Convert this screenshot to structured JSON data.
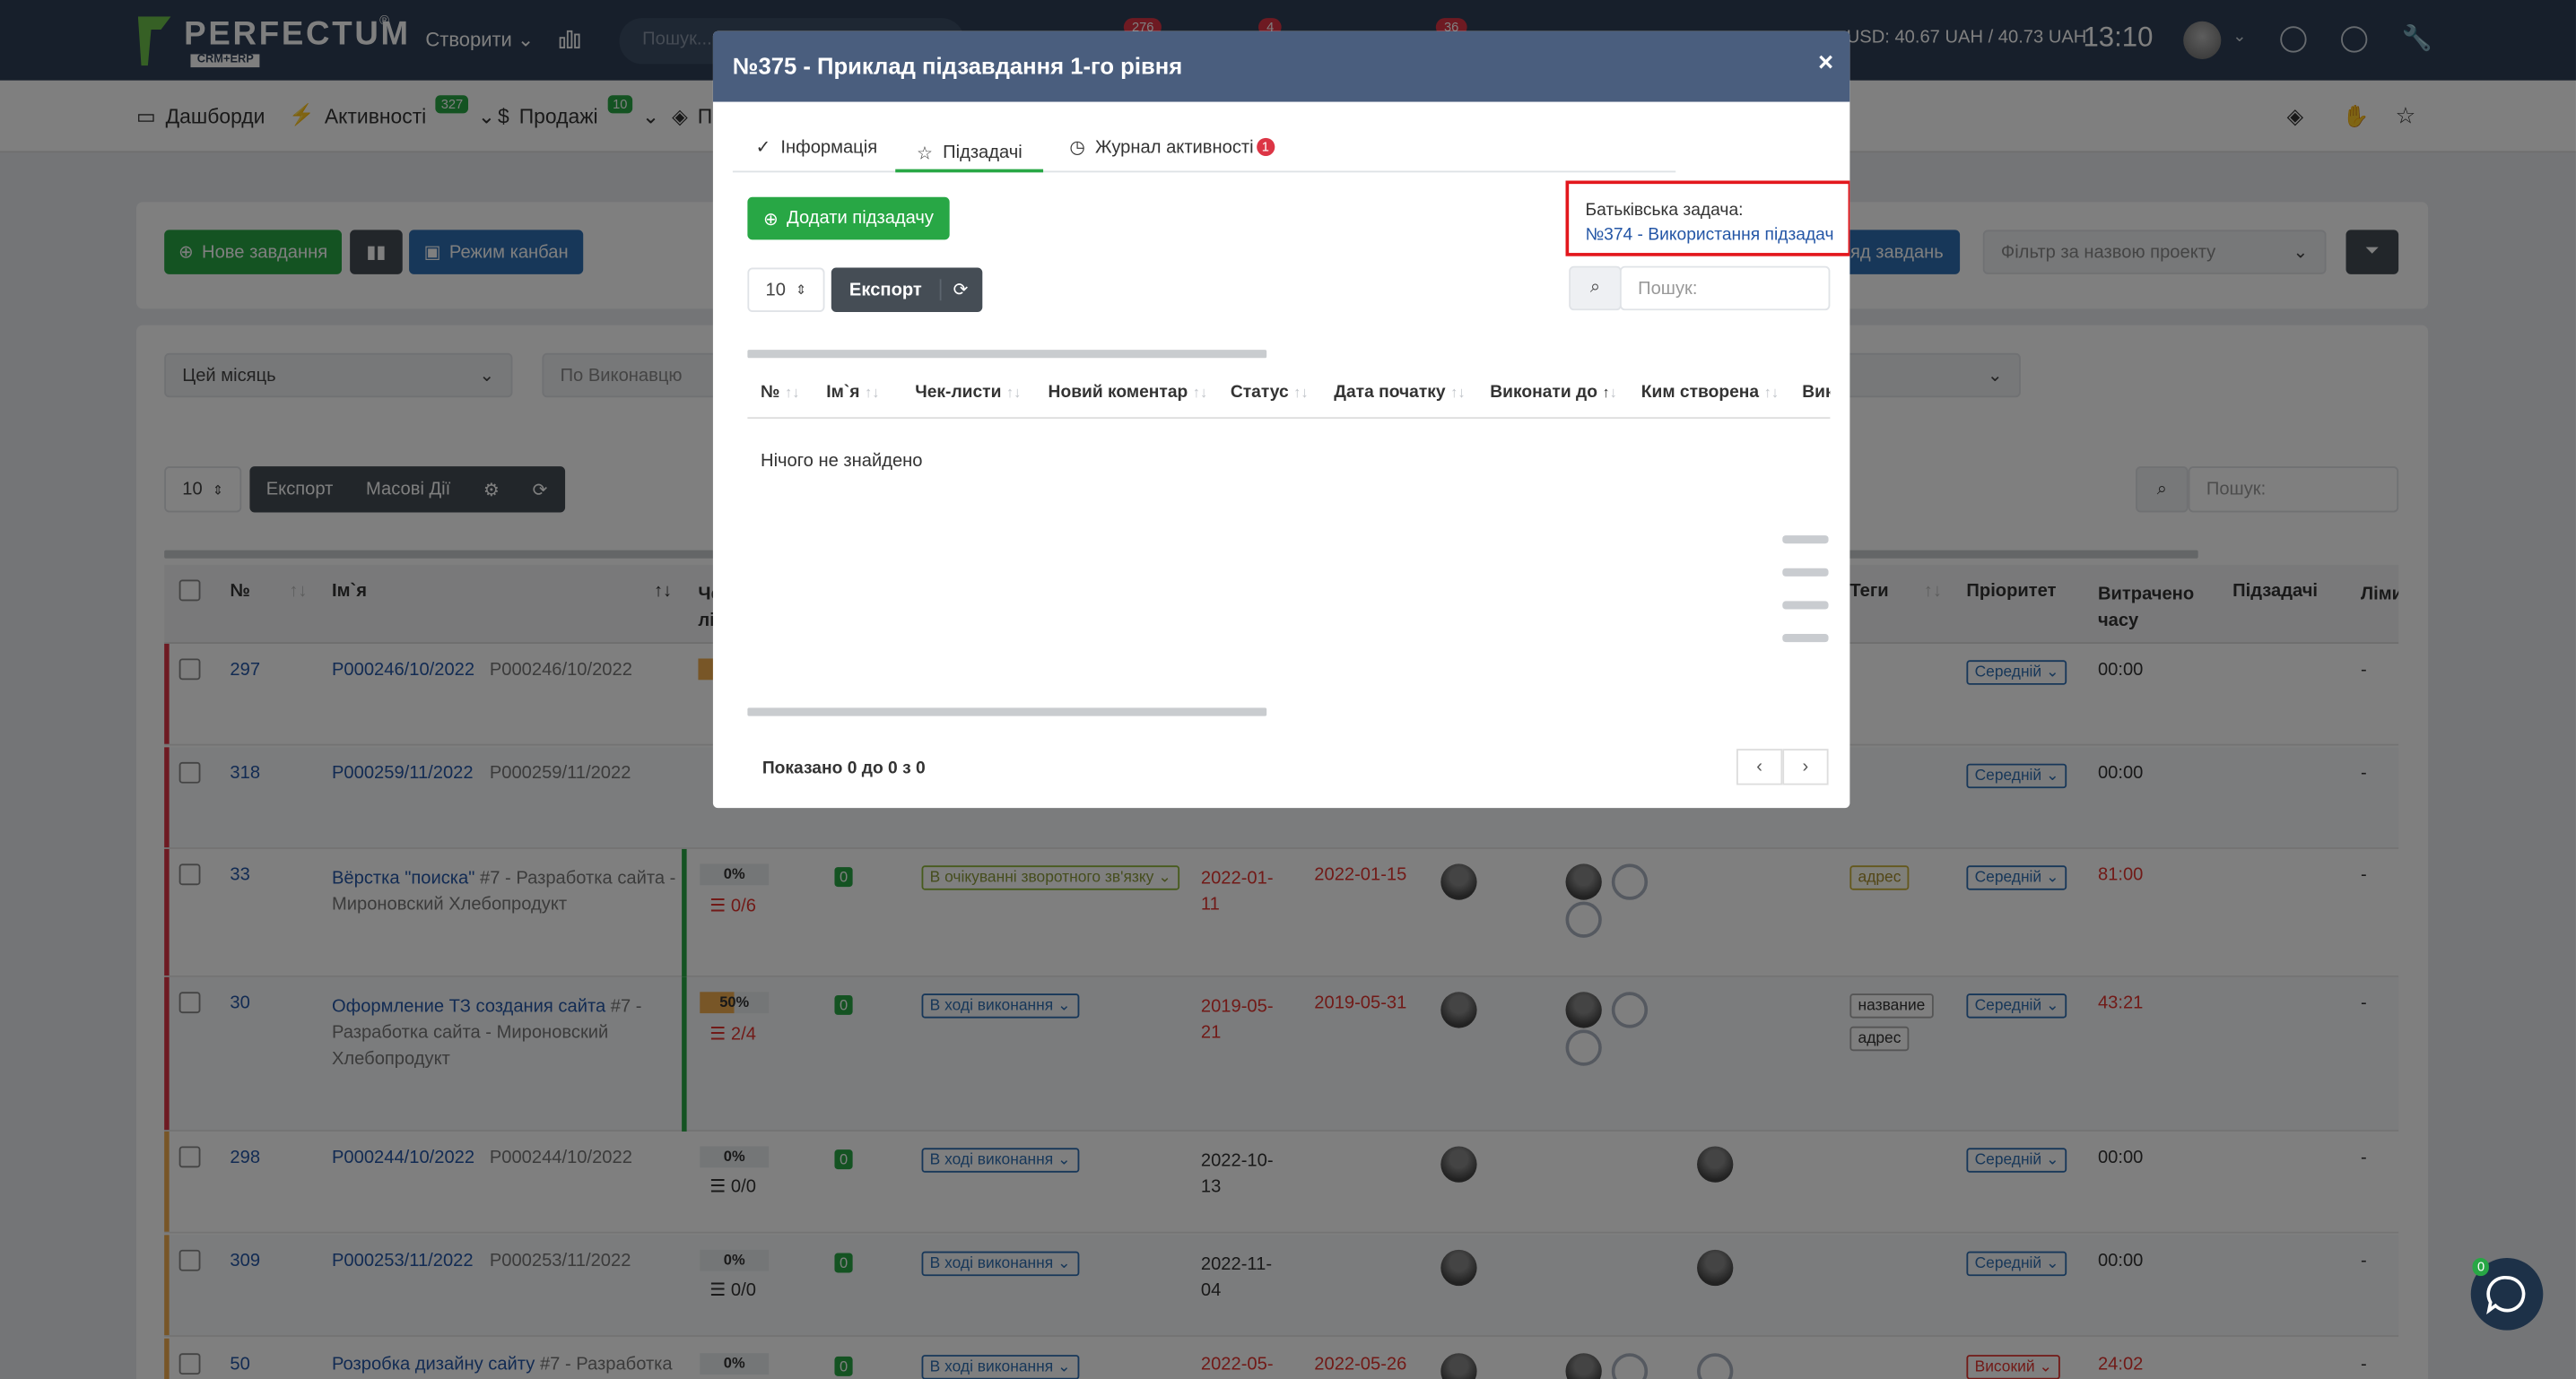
{
  "topbar": {
    "logo_text": "PERFECTUM",
    "logo_sub": "CRM+ERP",
    "logo_reg": "®",
    "create_label": "Створити ⌄",
    "search_placeholder": "Пошук...",
    "badges": [
      "276",
      "4",
      "36"
    ],
    "rate_text": "USD: 40.67 UAH / 40.73 UAH",
    "time": "13:10"
  },
  "menu": {
    "items": [
      {
        "label": "Дашборди",
        "icon": "dashboard-icon"
      },
      {
        "label": "Активності",
        "badge": "327",
        "icon": "activity-icon"
      },
      {
        "label": "Продажі",
        "badge": "10",
        "icon": "dollar-icon"
      },
      {
        "label": "П",
        "icon": "layers-icon"
      }
    ]
  },
  "toolbar": {
    "new_task": "Нове завдання",
    "kanban": "Режим канбан",
    "tasks_view": "яд завдань",
    "project_filter": "Фільтр за назвою проекту"
  },
  "filters": {
    "period": "Цей місяць",
    "by_executor": "По Виконавцю",
    "page_size": "10",
    "export": "Експорт",
    "mass_actions": "Масові Дії",
    "search_placeholder": "Пошук:"
  },
  "table": {
    "headers": [
      "№",
      "Ім`я",
      "Че лі",
      "Теги",
      "Пріоритет",
      "Витрачено часу",
      "Підзадачі",
      "Ліми врем"
    ],
    "rows": [
      {
        "num": "297",
        "name": "P000246/10/2022",
        "sub": "P000246/10/2022",
        "priority": "Середній",
        "spent": "00:00",
        "limit": "-",
        "bar": "#dc3545"
      },
      {
        "num": "318",
        "name": "P000259/11/2022",
        "sub": "P000259/11/2022",
        "priority": "Середній",
        "spent": "00:00",
        "limit": "-",
        "bar": "#dc3545"
      },
      {
        "num": "33",
        "name": "Вёрстка \"поиска\"",
        "sub": "#7 - Разработка сайта - Мироновский Хлебопродукт",
        "pct": "0%",
        "checklist": "0/6",
        "comments": "0",
        "status": "В очікуванні зворотного зв'язку",
        "start": "2022-01-11",
        "due": "2022-01-15",
        "tags": [
          "адрес"
        ],
        "priority": "Середній",
        "spent": "81:00",
        "limit": "-",
        "bar": "#dc3545"
      },
      {
        "num": "30",
        "name": "Оформление ТЗ создания сайта",
        "sub": "#7 - Разработка сайта - Мироновский Хлебопродукт",
        "pct": "50%",
        "checklist": "2/4",
        "comments": "0",
        "status": "В ході виконання",
        "start": "2019-05-21",
        "due": "2019-05-31",
        "tags": [
          "название",
          "адрес"
        ],
        "priority": "Середній",
        "spent": "43:21",
        "limit": "-",
        "bar": "#dc3545"
      },
      {
        "num": "298",
        "name": "P000244/10/2022",
        "sub": "P000244/10/2022",
        "pct": "0%",
        "checklist": "0/0",
        "comments": "0",
        "status": "В ході виконання",
        "start": "2022-10-13",
        "priority": "Середній",
        "spent": "00:00",
        "limit": "-",
        "bar": "#f0ad4e"
      },
      {
        "num": "309",
        "name": "P000253/11/2022",
        "sub": "P000253/11/2022",
        "pct": "0%",
        "checklist": "0/0",
        "comments": "0",
        "status": "В ході виконання",
        "start": "2022-11-04",
        "priority": "Середній",
        "spent": "00:00",
        "limit": "-",
        "bar": "#f0ad4e"
      },
      {
        "num": "50",
        "name": "Розробка дизайну сайту",
        "sub": "#7 - Разработка",
        "pct": "0%",
        "comments": "0",
        "status": "В ході виконання",
        "start": "2022-05-",
        "due": "2022-05-26",
        "priority": "Високий",
        "spent": "24:02",
        "limit": "-",
        "bar": "#f0ad4e"
      }
    ]
  },
  "modal": {
    "title": "№375 - Приклад підзавдання 1-го рівня",
    "close": "×",
    "tabs": [
      {
        "label": "Інформація",
        "icon": "check-circle-icon"
      },
      {
        "label": "Підзадачі",
        "icon": "star-icon"
      },
      {
        "label": "Журнал активності",
        "icon": "clock-icon",
        "badge": "1"
      }
    ],
    "add_subtask": "Додати підзадачу",
    "parent_label": "Батьківська задача:",
    "parent_link": "№374 - Використання підзадач",
    "page_size": "10",
    "export": "Експорт",
    "search_placeholder": "Пошук:",
    "headers": [
      "№",
      "Ім`я",
      "Чек-листи",
      "Новий коментар",
      "Статус",
      "Дата початку",
      "Виконати до",
      "Ким створена",
      "Вик"
    ],
    "empty_text": "Нічого не знайдено",
    "shown_text": "Показано 0 до 0 з 0"
  },
  "chat": {
    "badge": "0"
  }
}
